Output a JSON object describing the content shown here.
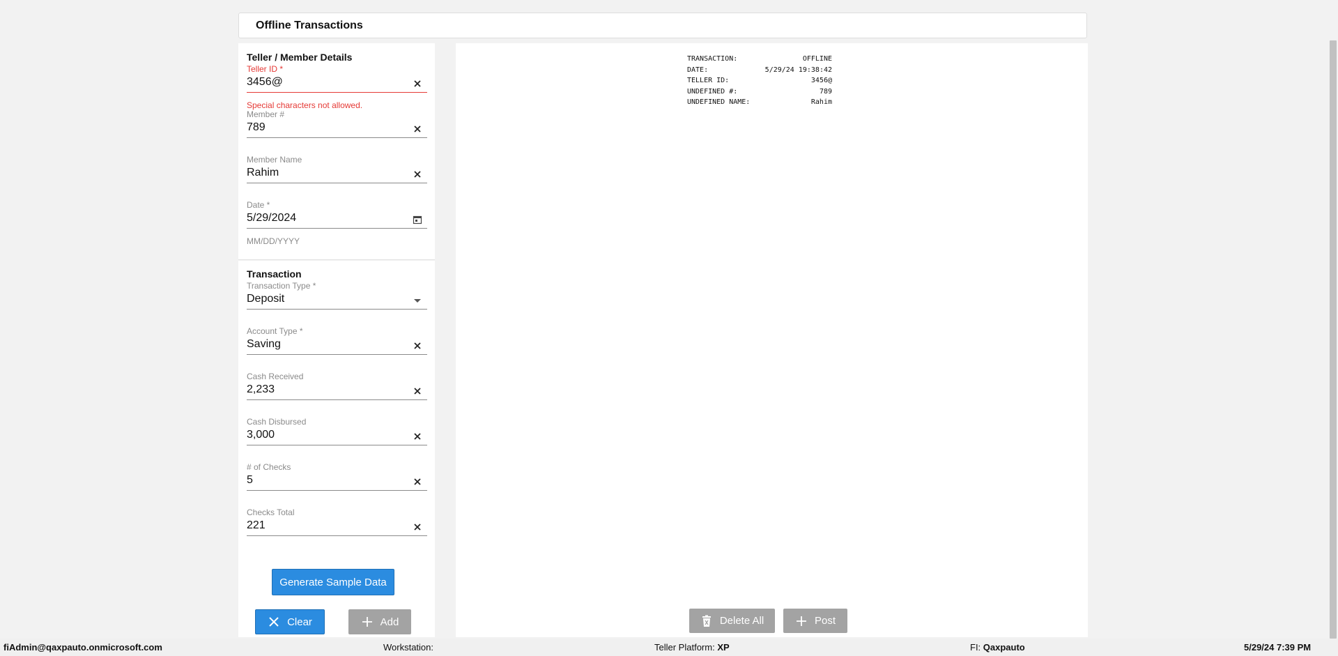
{
  "header": {
    "title": "Offline Transactions"
  },
  "teller_section": {
    "title": "Teller / Member Details",
    "teller_id": {
      "label": "Teller ID *",
      "value": "3456@",
      "error": "Special characters not allowed."
    },
    "member_number": {
      "label": "Member #",
      "value": "789"
    },
    "member_name": {
      "label": "Member Name",
      "value": "Rahim"
    },
    "date": {
      "label": "Date *",
      "value": "5/29/2024",
      "helper": "MM/DD/YYYY"
    }
  },
  "transaction_section": {
    "title": "Transaction",
    "transaction_type": {
      "label": "Transaction Type *",
      "value": "Deposit"
    },
    "account_type": {
      "label": "Account Type *",
      "value": "Saving"
    },
    "cash_received": {
      "label": "Cash Received",
      "value": "2,233"
    },
    "cash_disbursed": {
      "label": "Cash Disbursed",
      "value": "3,000"
    },
    "num_checks": {
      "label": "# of Checks",
      "value": "5"
    },
    "checks_total": {
      "label": "Checks Total",
      "value": "221"
    }
  },
  "buttons": {
    "generate": "Generate Sample Data",
    "clear": "Clear",
    "add": "Add",
    "delete_all": "Delete All",
    "post": "Post"
  },
  "receipt": {
    "rows": [
      {
        "label": "TRANSACTION:",
        "value": "OFFLINE"
      },
      {
        "label": "DATE:",
        "value": "5/29/24 19:38:42"
      },
      {
        "label": "TELLER ID:",
        "value": "3456@"
      },
      {
        "label": "UNDEFINED #:",
        "value": "789"
      },
      {
        "label": "UNDEFINED NAME:",
        "value": "Rahim"
      }
    ]
  },
  "status_bar": {
    "user": "fiAdmin@qaxpauto.onmicrosoft.com",
    "workstation_label": "Workstation:",
    "workstation_value": "",
    "platform_label": "Teller Platform:",
    "platform_value": "XP",
    "fi_label": "FI:",
    "fi_value": "Qaxpauto",
    "datetime": "5/29/24 7:39 PM"
  },
  "icons": {
    "clear_field": "close-icon",
    "calendar": "calendar-icon",
    "dropdown": "dropdown-arrow-icon",
    "clear_button": "close-icon",
    "add_button": "plus-icon",
    "delete_button": "trash-icon",
    "post_button": "plus-icon"
  },
  "colors": {
    "primary": "#2b8ce0",
    "error": "#e53935",
    "disabled_button": "#a3a3a3"
  }
}
